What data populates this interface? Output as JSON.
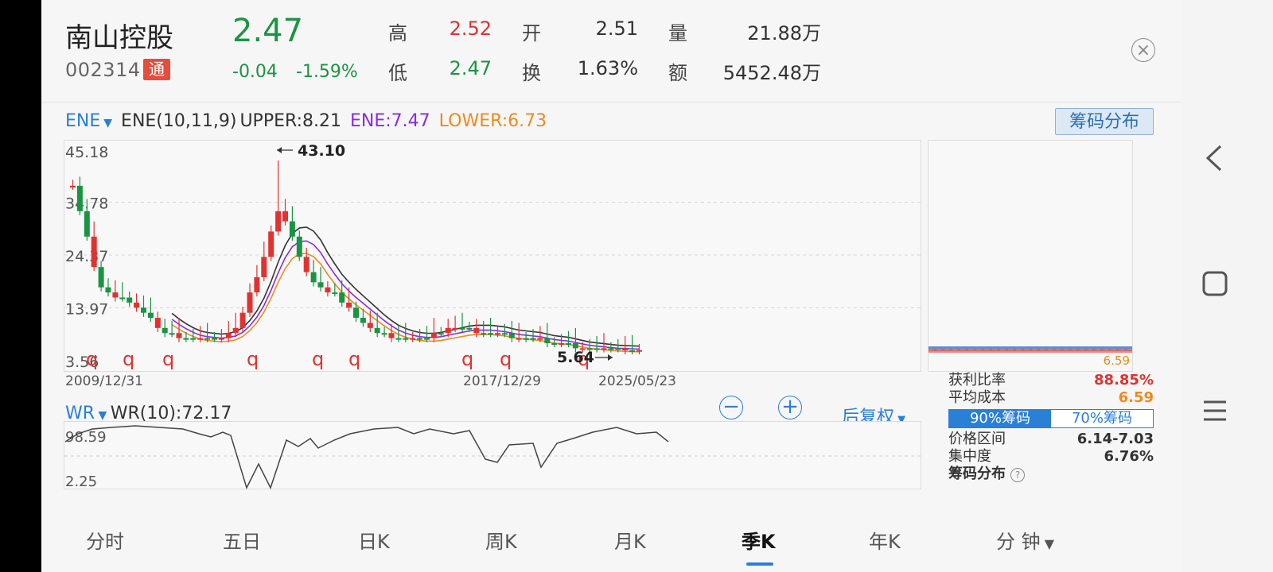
{
  "stock": {
    "name": "南山控股",
    "code": "002314",
    "badge": "通",
    "price": "2.47",
    "change": "-0.04",
    "change_pct": "-1.59%"
  },
  "quote": {
    "high_label": "高",
    "high": "2.52",
    "low_label": "低",
    "low": "2.47",
    "open_label": "开",
    "open": "2.51",
    "turnover_label": "换",
    "turnover": "1.63%",
    "volume_label": "量",
    "volume": "21.88万",
    "amount_label": "额",
    "amount": "5452.48万"
  },
  "indicator": {
    "name": "ENE",
    "params": "ENE(10,11,9)",
    "upper": "UPPER:8.21",
    "mid": "ENE:7.47",
    "lower": "LOWER:6.73"
  },
  "chip_button": "筹码分布",
  "main_chart": {
    "y_ticks": [
      "45.18",
      "34.78",
      "24.37",
      "13.97",
      "3.56"
    ],
    "x_ticks": [
      "2009/12/31",
      "2017/12/29",
      "2025/05/23"
    ],
    "max_label": "43.10",
    "min_label": "5.64",
    "marker": "q",
    "chip_price": "6.59"
  },
  "wr": {
    "name": "WR",
    "param": "WR(10):72.17",
    "y_ticks": [
      "98.59",
      "2.25"
    ],
    "adjust": "后复权"
  },
  "cost": {
    "profit_label": "获利比率",
    "profit": "88.85%",
    "avg_label": "平均成本",
    "avg": "6.59",
    "tab90": "90%筹码",
    "tab70": "70%筹码",
    "range_label": "价格区间",
    "range": "6.14-7.03",
    "conc_label": "集中度",
    "conc": "6.76%",
    "dist_label": "筹码分布"
  },
  "tabs": [
    "分时",
    "五日",
    "日K",
    "周K",
    "月K",
    "季K",
    "年K",
    "分 钟"
  ],
  "active_tab": "季K",
  "colors": {
    "up": "#e0332f",
    "down": "#1a9442",
    "accent": "#2a7fd6",
    "upper": "#333333",
    "ene": "#8a2be2",
    "lower": "#ee8a1d"
  },
  "chart_data": {
    "type": "candlestick",
    "title": "",
    "ylim": [
      3.56,
      45.18
    ],
    "series": [
      {
        "values": [
          38,
          33,
          28,
          22,
          18,
          17,
          16,
          16,
          15,
          14,
          13,
          12,
          10,
          9,
          9,
          8,
          8,
          8,
          8,
          8,
          8,
          8,
          9,
          10,
          13,
          17,
          20,
          24,
          29,
          33,
          31,
          28,
          24,
          21,
          19,
          18,
          17,
          17,
          15,
          14,
          12,
          11,
          10,
          9,
          9,
          8,
          8,
          8,
          8,
          8,
          8,
          9,
          9,
          10,
          10,
          10,
          10,
          9,
          9,
          9,
          9,
          9,
          8,
          8,
          8,
          8,
          8,
          7,
          7,
          7,
          7,
          6,
          6,
          6,
          6,
          6,
          6,
          6,
          5.6,
          5.6,
          5.64
        ]
      }
    ]
  }
}
